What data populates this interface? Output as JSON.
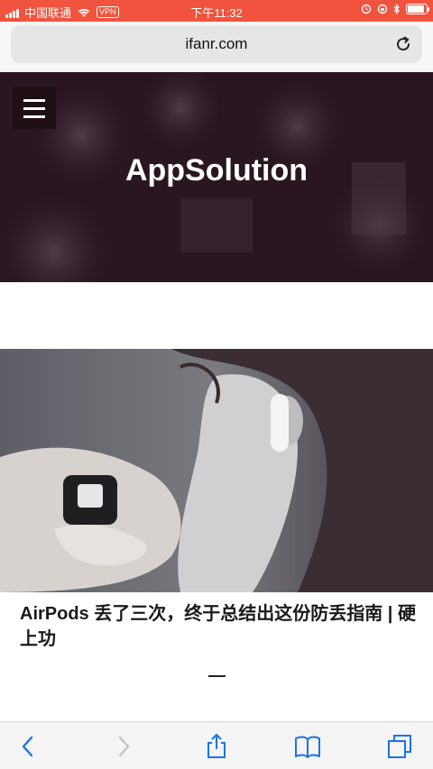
{
  "status_bar": {
    "carrier": "中国联通",
    "vpn_label": "VPN",
    "time": "下午11:32",
    "battery_level": 0.9
  },
  "address_bar": {
    "url": "ifanr.com"
  },
  "hero": {
    "title": "AppSolution"
  },
  "article": {
    "title": "AirPods 丢了三次，终于总结出这份防丢指南 | 硬上功"
  },
  "colors": {
    "status_bar_bg": "#f0533e",
    "hero_bg": "#2a1620",
    "accent": "#1a73e8"
  },
  "icons": {
    "menu": "hamburger-icon",
    "reload": "reload-icon",
    "back": "chevron-left-icon",
    "forward": "chevron-right-icon",
    "share": "share-icon",
    "bookmarks": "book-icon",
    "tabs": "tabs-icon"
  }
}
